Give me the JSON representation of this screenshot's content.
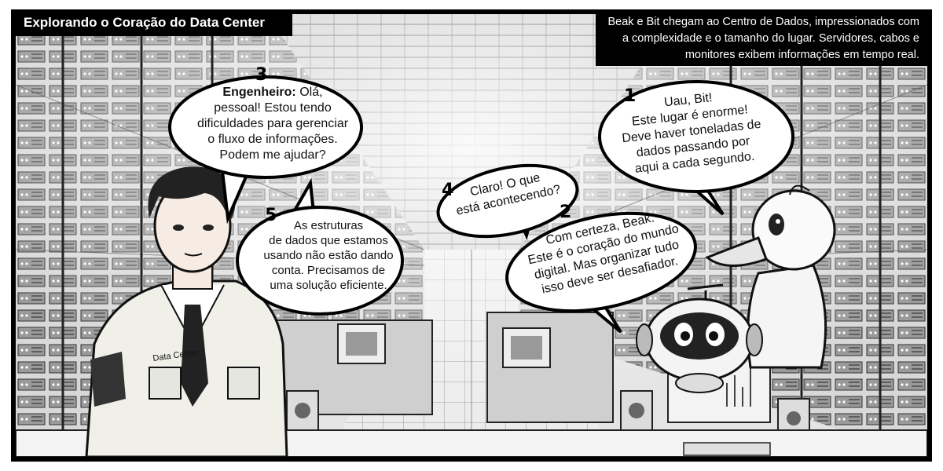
{
  "title": "Explorando o Coração do Data Center",
  "caption": "Beak e Bit chegam ao Centro de Dados, impressionados com a complexidade e o tamanho do lugar. Servidores, cabos e monitores exibem informações em tempo real.",
  "bubbles": [
    {
      "number": "1",
      "speaker": "",
      "text": [
        "Uau, Bit!",
        "Este lugar é enorme!",
        "Deve haver toneladas de",
        "dados passando por",
        "aqui a cada segundo."
      ]
    },
    {
      "number": "2",
      "speaker": "",
      "text": [
        "Com certeza, Beak.",
        "Este é o coração do mundo",
        "digital. Mas organizar tudo",
        "isso deve ser desafiador."
      ]
    },
    {
      "number": "3",
      "speaker": "Engenheiro:",
      "text": [
        "Olá,",
        "pessoal! Estou tendo",
        "dificuldades para gerenciar",
        "o fluxo de informações.",
        "Podem me ajudar?"
      ]
    },
    {
      "number": "4",
      "speaker": "",
      "text": [
        "Claro! O que",
        "está acontecendo?"
      ]
    },
    {
      "number": "5",
      "speaker": "",
      "text": [
        "As estruturas",
        "de dados que estamos",
        "usando não estão dando",
        "conta. Precisamos de",
        "uma solução eficiente."
      ]
    }
  ],
  "badge_text": "Data Center",
  "colors": {
    "frame": "#000000",
    "background": "#e9e9e9",
    "ink": "#222222"
  }
}
